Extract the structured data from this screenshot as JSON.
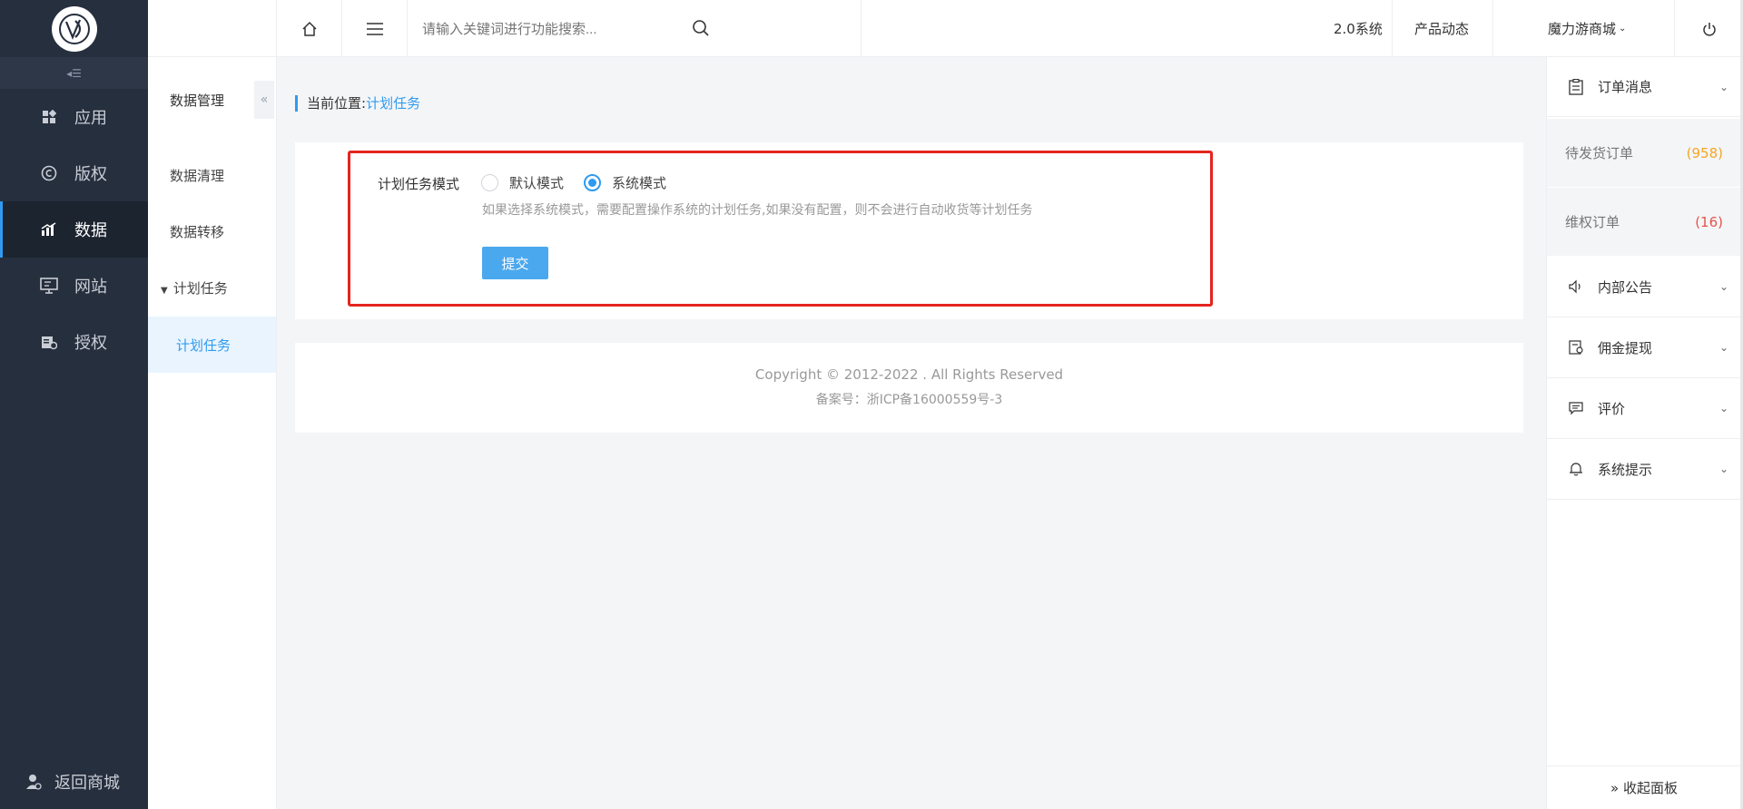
{
  "sidebar": {
    "items": [
      {
        "label": "应用",
        "icon": "apps-icon"
      },
      {
        "label": "版权",
        "icon": "copyright-icon"
      },
      {
        "label": "数据",
        "icon": "chart-icon",
        "active": true
      },
      {
        "label": "网站",
        "icon": "monitor-icon"
      },
      {
        "label": "授权",
        "icon": "authorize-icon"
      }
    ],
    "back_label": "返回商城"
  },
  "submenu": {
    "title": "数据管理",
    "items": [
      "数据清理",
      "数据转移"
    ],
    "group": "计划任务",
    "active_item": "计划任务"
  },
  "topbar": {
    "search_placeholder": "请输入关键词进行功能搜索...",
    "version": "2.0系统",
    "product_news": "产品动态",
    "store_name": "魔力游商城"
  },
  "breadcrumb": {
    "prefix": "当前位置:",
    "current": "计划任务"
  },
  "form": {
    "label": "计划任务模式",
    "options": [
      "默认模式",
      "系统模式"
    ],
    "selected": "系统模式",
    "hint": "如果选择系统模式，需要配置操作系统的计划任务,如果没有配置，则不会进行自动收货等计划任务",
    "submit_label": "提交"
  },
  "footer": {
    "copyright": "Copyright © 2012-2022 . All Rights Reserved",
    "icp": "备案号：浙ICP备16000559号-3"
  },
  "right_panel": {
    "order_title": "订单消息",
    "order_items": [
      {
        "label": "待发货订单",
        "count": "(958)",
        "color": "#f5a623"
      },
      {
        "label": "维权订单",
        "count": "(16)",
        "color": "#e5534b"
      }
    ],
    "sections": [
      "内部公告",
      "佣金提现",
      "评价",
      "系统提示"
    ],
    "fold_label": "» 收起面板"
  }
}
